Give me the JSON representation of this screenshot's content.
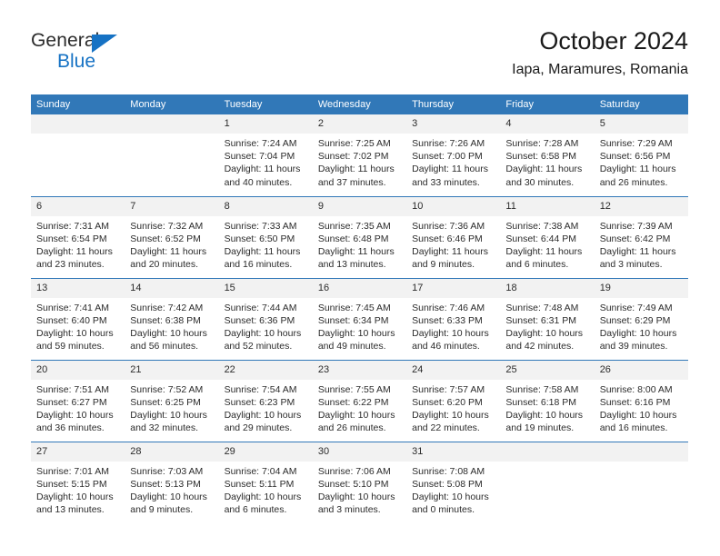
{
  "brand": {
    "name_part1": "General",
    "name_part2": "Blue",
    "logo_icon": "triangle-logo-icon",
    "accent_color": "#1672c4"
  },
  "header": {
    "title": "October 2024",
    "subtitle": "Iapa, Maramures, Romania",
    "header_bg_color": "#3178b8",
    "daynum_bg_color": "#f2f2f2"
  },
  "weekday_headers": [
    "Sunday",
    "Monday",
    "Tuesday",
    "Wednesday",
    "Thursday",
    "Friday",
    "Saturday"
  ],
  "labels": {
    "sunrise_prefix": "Sunrise:",
    "sunset_prefix": "Sunset:",
    "daylight_prefix": "Daylight:"
  },
  "weeks": [
    [
      {
        "day": "",
        "empty": true,
        "line1": "",
        "line2": "",
        "line3": "",
        "line4": ""
      },
      {
        "day": "",
        "empty": true,
        "line1": "",
        "line2": "",
        "line3": "",
        "line4": ""
      },
      {
        "day": "1",
        "line1": "Sunrise: 7:24 AM",
        "line2": "Sunset: 7:04 PM",
        "line3": "Daylight: 11 hours",
        "line4": "and 40 minutes."
      },
      {
        "day": "2",
        "line1": "Sunrise: 7:25 AM",
        "line2": "Sunset: 7:02 PM",
        "line3": "Daylight: 11 hours",
        "line4": "and 37 minutes."
      },
      {
        "day": "3",
        "line1": "Sunrise: 7:26 AM",
        "line2": "Sunset: 7:00 PM",
        "line3": "Daylight: 11 hours",
        "line4": "and 33 minutes."
      },
      {
        "day": "4",
        "line1": "Sunrise: 7:28 AM",
        "line2": "Sunset: 6:58 PM",
        "line3": "Daylight: 11 hours",
        "line4": "and 30 minutes."
      },
      {
        "day": "5",
        "line1": "Sunrise: 7:29 AM",
        "line2": "Sunset: 6:56 PM",
        "line3": "Daylight: 11 hours",
        "line4": "and 26 minutes."
      }
    ],
    [
      {
        "day": "6",
        "line1": "Sunrise: 7:31 AM",
        "line2": "Sunset: 6:54 PM",
        "line3": "Daylight: 11 hours",
        "line4": "and 23 minutes."
      },
      {
        "day": "7",
        "line1": "Sunrise: 7:32 AM",
        "line2": "Sunset: 6:52 PM",
        "line3": "Daylight: 11 hours",
        "line4": "and 20 minutes."
      },
      {
        "day": "8",
        "line1": "Sunrise: 7:33 AM",
        "line2": "Sunset: 6:50 PM",
        "line3": "Daylight: 11 hours",
        "line4": "and 16 minutes."
      },
      {
        "day": "9",
        "line1": "Sunrise: 7:35 AM",
        "line2": "Sunset: 6:48 PM",
        "line3": "Daylight: 11 hours",
        "line4": "and 13 minutes."
      },
      {
        "day": "10",
        "line1": "Sunrise: 7:36 AM",
        "line2": "Sunset: 6:46 PM",
        "line3": "Daylight: 11 hours",
        "line4": "and 9 minutes."
      },
      {
        "day": "11",
        "line1": "Sunrise: 7:38 AM",
        "line2": "Sunset: 6:44 PM",
        "line3": "Daylight: 11 hours",
        "line4": "and 6 minutes."
      },
      {
        "day": "12",
        "line1": "Sunrise: 7:39 AM",
        "line2": "Sunset: 6:42 PM",
        "line3": "Daylight: 11 hours",
        "line4": "and 3 minutes."
      }
    ],
    [
      {
        "day": "13",
        "line1": "Sunrise: 7:41 AM",
        "line2": "Sunset: 6:40 PM",
        "line3": "Daylight: 10 hours",
        "line4": "and 59 minutes."
      },
      {
        "day": "14",
        "line1": "Sunrise: 7:42 AM",
        "line2": "Sunset: 6:38 PM",
        "line3": "Daylight: 10 hours",
        "line4": "and 56 minutes."
      },
      {
        "day": "15",
        "line1": "Sunrise: 7:44 AM",
        "line2": "Sunset: 6:36 PM",
        "line3": "Daylight: 10 hours",
        "line4": "and 52 minutes."
      },
      {
        "day": "16",
        "line1": "Sunrise: 7:45 AM",
        "line2": "Sunset: 6:34 PM",
        "line3": "Daylight: 10 hours",
        "line4": "and 49 minutes."
      },
      {
        "day": "17",
        "line1": "Sunrise: 7:46 AM",
        "line2": "Sunset: 6:33 PM",
        "line3": "Daylight: 10 hours",
        "line4": "and 46 minutes."
      },
      {
        "day": "18",
        "line1": "Sunrise: 7:48 AM",
        "line2": "Sunset: 6:31 PM",
        "line3": "Daylight: 10 hours",
        "line4": "and 42 minutes."
      },
      {
        "day": "19",
        "line1": "Sunrise: 7:49 AM",
        "line2": "Sunset: 6:29 PM",
        "line3": "Daylight: 10 hours",
        "line4": "and 39 minutes."
      }
    ],
    [
      {
        "day": "20",
        "line1": "Sunrise: 7:51 AM",
        "line2": "Sunset: 6:27 PM",
        "line3": "Daylight: 10 hours",
        "line4": "and 36 minutes."
      },
      {
        "day": "21",
        "line1": "Sunrise: 7:52 AM",
        "line2": "Sunset: 6:25 PM",
        "line3": "Daylight: 10 hours",
        "line4": "and 32 minutes."
      },
      {
        "day": "22",
        "line1": "Sunrise: 7:54 AM",
        "line2": "Sunset: 6:23 PM",
        "line3": "Daylight: 10 hours",
        "line4": "and 29 minutes."
      },
      {
        "day": "23",
        "line1": "Sunrise: 7:55 AM",
        "line2": "Sunset: 6:22 PM",
        "line3": "Daylight: 10 hours",
        "line4": "and 26 minutes."
      },
      {
        "day": "24",
        "line1": "Sunrise: 7:57 AM",
        "line2": "Sunset: 6:20 PM",
        "line3": "Daylight: 10 hours",
        "line4": "and 22 minutes."
      },
      {
        "day": "25",
        "line1": "Sunrise: 7:58 AM",
        "line2": "Sunset: 6:18 PM",
        "line3": "Daylight: 10 hours",
        "line4": "and 19 minutes."
      },
      {
        "day": "26",
        "line1": "Sunrise: 8:00 AM",
        "line2": "Sunset: 6:16 PM",
        "line3": "Daylight: 10 hours",
        "line4": "and 16 minutes."
      }
    ],
    [
      {
        "day": "27",
        "line1": "Sunrise: 7:01 AM",
        "line2": "Sunset: 5:15 PM",
        "line3": "Daylight: 10 hours",
        "line4": "and 13 minutes."
      },
      {
        "day": "28",
        "line1": "Sunrise: 7:03 AM",
        "line2": "Sunset: 5:13 PM",
        "line3": "Daylight: 10 hours",
        "line4": "and 9 minutes."
      },
      {
        "day": "29",
        "line1": "Sunrise: 7:04 AM",
        "line2": "Sunset: 5:11 PM",
        "line3": "Daylight: 10 hours",
        "line4": "and 6 minutes."
      },
      {
        "day": "30",
        "line1": "Sunrise: 7:06 AM",
        "line2": "Sunset: 5:10 PM",
        "line3": "Daylight: 10 hours",
        "line4": "and 3 minutes."
      },
      {
        "day": "31",
        "line1": "Sunrise: 7:08 AM",
        "line2": "Sunset: 5:08 PM",
        "line3": "Daylight: 10 hours",
        "line4": "and 0 minutes."
      },
      {
        "day": "",
        "empty": true,
        "line1": "",
        "line2": "",
        "line3": "",
        "line4": ""
      },
      {
        "day": "",
        "empty": true,
        "line1": "",
        "line2": "",
        "line3": "",
        "line4": ""
      }
    ]
  ]
}
